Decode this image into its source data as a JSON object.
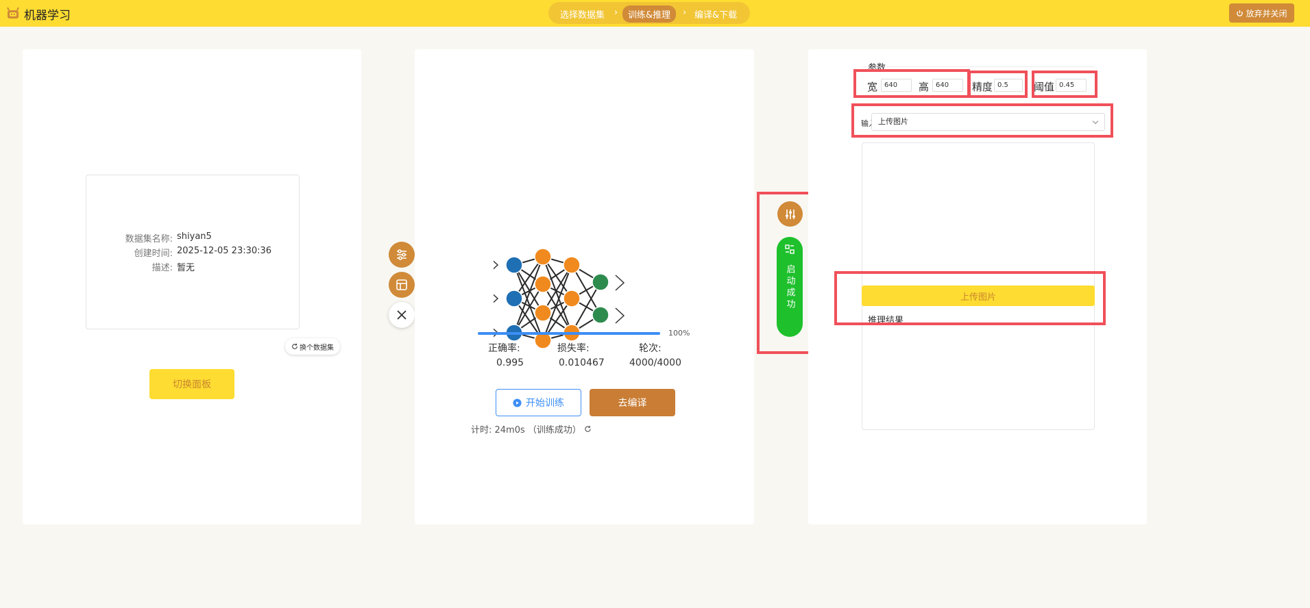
{
  "header": {
    "app_title": "机器学习",
    "steps": [
      "选择数据集",
      "训练&推理",
      "编译&下载"
    ],
    "active_step_index": 1,
    "exit_label": "放弃并关闭"
  },
  "dataset": {
    "name_label": "数据集名称:",
    "name_value": "shiyan5",
    "created_label": "创建时间:",
    "created_value": "2025-12-05 23:30:36",
    "desc_label": "描述:",
    "desc_value": "暂无",
    "switch_dataset_label": "换个数据集",
    "toggle_panel_label": "切换面板"
  },
  "training": {
    "progress_percent": 100,
    "progress_text": "100%",
    "accuracy_label": "正确率:",
    "accuracy_value": "0.995",
    "loss_label": "损失率:",
    "loss_value": "0.010467",
    "epoch_label": "轮次:",
    "epoch_value": "4000/4000",
    "start_label": "开始训练",
    "compile_label": "去编译",
    "timer_text": "计时: 24m0s （训练成功）"
  },
  "launch": {
    "status_label": "启动成功"
  },
  "inference": {
    "params_title": "参数",
    "width_label": "宽",
    "width_value": "640",
    "height_label": "高",
    "height_value": "640",
    "precision_label": "精度",
    "precision_value": "0.5",
    "threshold_label": "阈值",
    "threshold_value": "0.45",
    "input_label": "输入",
    "input_selected": "上传图片",
    "upload_label": "上传图片",
    "result_title": "推理结果"
  },
  "colors": {
    "brand_yellow": "#fedc32",
    "accent_orange": "#d08a38",
    "success_green": "#1ec02c",
    "primary_blue": "#3d8ef5",
    "highlight_red": "#f0505a",
    "node_blue": "#1f6fb4",
    "node_orange": "#f08a1e",
    "node_green": "#2e8b4e"
  },
  "icons": [
    "robot-logo-icon",
    "power-icon",
    "refresh-icon",
    "sliders-icon",
    "layout-icon",
    "close-icon",
    "play-circle-icon",
    "scan-icon",
    "chevron-down-icon"
  ]
}
